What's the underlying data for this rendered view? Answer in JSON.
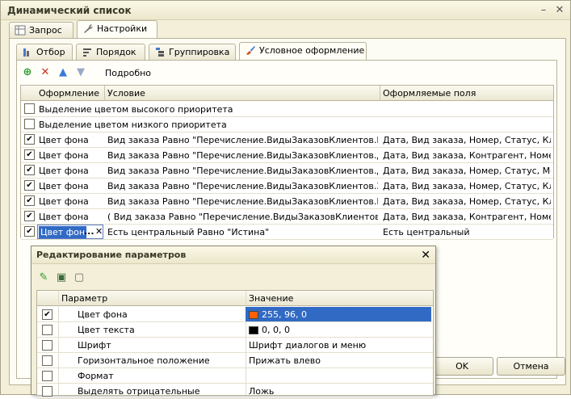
{
  "window": {
    "title": "Динамический список"
  },
  "top_tabs": [
    {
      "label": "Запрос"
    },
    {
      "label": "Настройки"
    }
  ],
  "inner_tabs": [
    {
      "label": "Отбор"
    },
    {
      "label": "Порядок"
    },
    {
      "label": "Группировка"
    },
    {
      "label": "Условное оформление"
    }
  ],
  "toolbar": {
    "details_label": "Подробно"
  },
  "grid": {
    "headers": [
      "Оформление",
      "Условие",
      "Оформляемые поля"
    ],
    "rows": [
      {
        "checked": false,
        "wide": "Выделение цветом высокого приоритета"
      },
      {
        "checked": false,
        "wide": "Выделение цветом низкого приоритета"
      },
      {
        "checked": true,
        "look": "Цвет фона",
        "condition": "Вид заказа Равно \"Перечисление.ВидыЗаказовКлиентов.Реал...",
        "fields": "Дата, Вид заказа, Номер, Статус, Кли..."
      },
      {
        "checked": true,
        "look": "Цвет фона",
        "condition": "Вид заказа Равно \"Перечисление.ВидыЗаказовКлиентов.Дост...",
        "fields": "Дата, Вид заказа, Контрагент, Номер..."
      },
      {
        "checked": true,
        "look": "Цвет фона",
        "condition": "Вид заказа Равно \"Перечисление.ВидыЗаказовКлиентов.Дост...",
        "fields": "Дата, Вид заказа, Номер, Статус, Ме..."
      },
      {
        "checked": true,
        "look": "Цвет фона",
        "condition": "Вид заказа Равно \"Перечисление.ВидыЗаказовКлиентов.Заре...",
        "fields": "Дата, Вид заказа, Номер, Статус, Кли..."
      },
      {
        "checked": true,
        "look": "Цвет фона",
        "condition": "Вид заказа Равно \"Перечисление.ВидыЗаказовКлиентов.Прод...",
        "fields": "Дата, Вид заказа, Номер, Статус, Кли..."
      },
      {
        "checked": true,
        "look": "Цвет фона",
        "condition": "( Вид заказа Равно \"Перечисление.ВидыЗаказовКлиентов.До...",
        "fields": "Дата, Вид заказа, Контрагент, Номер..."
      },
      {
        "checked": true,
        "look": "Цвет фон",
        "condition": "Есть центральный Равно \"Истина\"",
        "fields": "Есть центральный",
        "editing": true
      }
    ]
  },
  "dialog": {
    "title": "Редактирование параметров",
    "headers": [
      "Параметр",
      "Значение"
    ],
    "rows": [
      {
        "checked": true,
        "param": "Цвет фона",
        "value": "255, 96, 0",
        "swatch": "#ff6000",
        "selected": true
      },
      {
        "checked": false,
        "param": "Цвет текста",
        "value": "0, 0, 0",
        "swatch": "#000000"
      },
      {
        "checked": false,
        "param": "Шрифт",
        "value": "Шрифт диалогов и меню"
      },
      {
        "checked": false,
        "param": "Горизонтальное положение",
        "value": "Прижать влево"
      },
      {
        "checked": false,
        "param": "Формат",
        "value": ""
      },
      {
        "checked": false,
        "param": "Выделять отрицательные",
        "value": "Ложь"
      }
    ]
  },
  "buttons": {
    "ok": "OK",
    "cancel": "Отмена"
  },
  "check_mark": "✔",
  "colors": {
    "accent": "#316ac5",
    "window_bg": "#f3efd8"
  }
}
